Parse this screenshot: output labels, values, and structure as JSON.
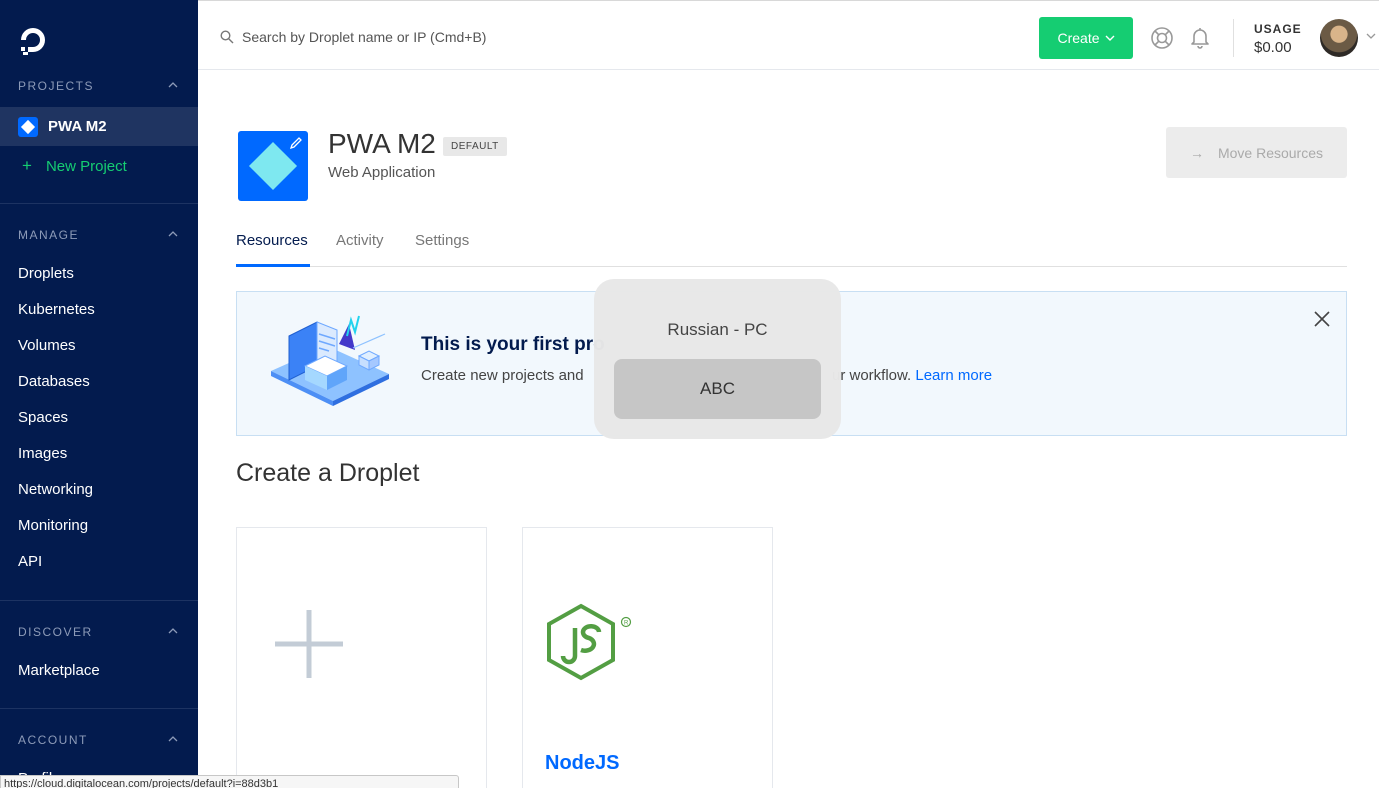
{
  "sidebar": {
    "logo": "digitalocean-logo",
    "projects_title": "PROJECTS",
    "active_project": "PWA M2",
    "new_project": "New Project",
    "manage_title": "MANAGE",
    "manage_items": [
      "Droplets",
      "Kubernetes",
      "Volumes",
      "Databases",
      "Spaces",
      "Images",
      "Networking",
      "Monitoring",
      "API"
    ],
    "discover_title": "DISCOVER",
    "discover_items": [
      "Marketplace"
    ],
    "account_title": "ACCOUNT",
    "account_items": [
      "Profile"
    ]
  },
  "header": {
    "search_placeholder": "Search by Droplet name or IP (Cmd+B)",
    "create_label": "Create",
    "usage_label": "USAGE",
    "usage_value": "$0.00"
  },
  "project": {
    "title": "PWA M2",
    "badge": "DEFAULT",
    "subtitle": "Web Application",
    "move_resources": "Move Resources"
  },
  "tabs": [
    "Resources",
    "Activity",
    "Settings"
  ],
  "banner": {
    "title": "This is your first pro",
    "text_left": "Create new projects and",
    "text_right": "ur workflow.",
    "learn_more": "Learn more"
  },
  "input_source_popup": {
    "title": "Russian - PC",
    "selected": "ABC"
  },
  "droplet_section": {
    "heading": "Create a Droplet",
    "cards": [
      {
        "icon": "plus-icon",
        "name": ""
      },
      {
        "icon": "nodejs-logo",
        "name": "NodeJS"
      }
    ]
  },
  "status_bar": {
    "url": "https://cloud.digitalocean.com/projects/default?i=88d3b1"
  },
  "colors": {
    "sidebar_bg": "#031b4e",
    "accent_blue": "#0069ff",
    "create_green": "#15cd72"
  }
}
